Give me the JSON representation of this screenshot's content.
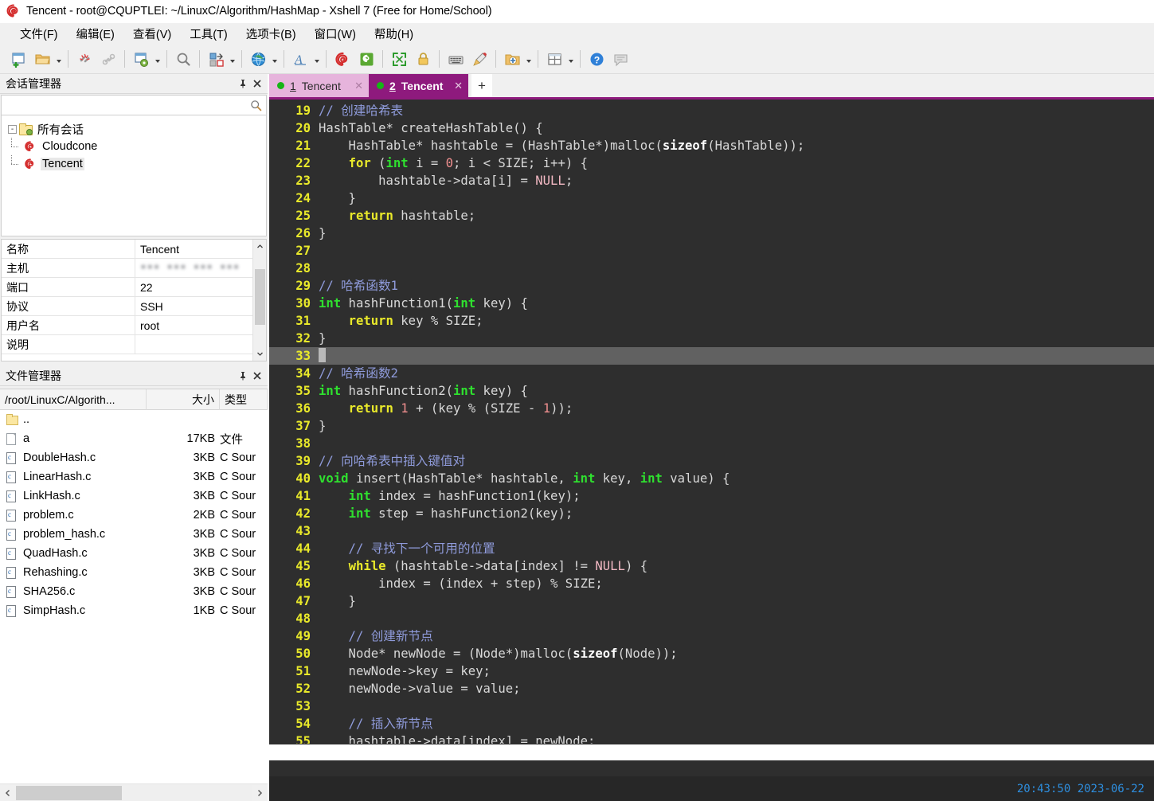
{
  "window": {
    "title": "Tencent - root@CQUPTLEI: ~/LinuxC/Algorithm/HashMap - Xshell 7 (Free for Home/School)",
    "logo_icon": "xshell-logo-icon"
  },
  "menubar": {
    "items": [
      {
        "label": "文件(F)",
        "name": "menu-file"
      },
      {
        "label": "编辑(E)",
        "name": "menu-edit"
      },
      {
        "label": "查看(V)",
        "name": "menu-view"
      },
      {
        "label": "工具(T)",
        "name": "menu-tools"
      },
      {
        "label": "选项卡(B)",
        "name": "menu-tabs"
      },
      {
        "label": "窗口(W)",
        "name": "menu-window"
      },
      {
        "label": "帮助(H)",
        "name": "menu-help"
      }
    ]
  },
  "toolbar": {
    "buttons": [
      "new-session-icon",
      "open-folder-icon",
      "disconnect-icon",
      "link-icon",
      "session-properties-icon",
      "find-icon",
      "transfer-files-icon",
      "globe-icon",
      "font-icon",
      "xshell-icon",
      "xftp-icon",
      "fullscreen-icon",
      "lock-icon",
      "keyboard-icon",
      "highlight-icon",
      "add-folder-icon",
      "layout-icon",
      "help-icon",
      "feedback-icon"
    ]
  },
  "session_manager": {
    "title": "会话管理器",
    "pin_icon": "pin-icon",
    "close_icon": "close-icon",
    "search_placeholder": "",
    "search_value": "",
    "search_icon": "search-icon",
    "tree": {
      "root_label": "所有会话",
      "root_expanded": "-",
      "children": [
        {
          "label": "Cloudcone",
          "selected": false
        },
        {
          "label": "Tencent",
          "selected": true
        }
      ]
    }
  },
  "properties": {
    "rows": [
      {
        "key": "名称",
        "value": "Tencent",
        "blurred": false
      },
      {
        "key": "主机",
        "value": "••• ••• ••• •••",
        "blurred": true
      },
      {
        "key": "端口",
        "value": "22",
        "blurred": false
      },
      {
        "key": "协议",
        "value": "SSH",
        "blurred": false
      },
      {
        "key": "用户名",
        "value": "root",
        "blurred": false
      },
      {
        "key": "说明",
        "value": "",
        "blurred": false
      }
    ]
  },
  "file_manager": {
    "title": "文件管理器",
    "pin_icon": "pin-icon",
    "close_icon": "close-icon",
    "columns": {
      "path": "/root/LinuxC/Algorith...",
      "size": "大小",
      "type": "类型"
    },
    "rows": [
      {
        "name": "..",
        "size": "",
        "type": "",
        "icon": "folder-up-icon"
      },
      {
        "name": "a",
        "size": "17KB",
        "type": "文件",
        "icon": "file-icon"
      },
      {
        "name": "DoubleHash.c",
        "size": "3KB",
        "type": "C Sour",
        "icon": "c-source-icon"
      },
      {
        "name": "LinearHash.c",
        "size": "3KB",
        "type": "C Sour",
        "icon": "c-source-icon"
      },
      {
        "name": "LinkHash.c",
        "size": "3KB",
        "type": "C Sour",
        "icon": "c-source-icon"
      },
      {
        "name": "problem.c",
        "size": "2KB",
        "type": "C Sour",
        "icon": "c-source-icon"
      },
      {
        "name": "problem_hash.c",
        "size": "3KB",
        "type": "C Sour",
        "icon": "c-source-icon"
      },
      {
        "name": "QuadHash.c",
        "size": "3KB",
        "type": "C Sour",
        "icon": "c-source-icon"
      },
      {
        "name": "Rehashing.c",
        "size": "3KB",
        "type": "C Sour",
        "icon": "c-source-icon"
      },
      {
        "name": "SHA256.c",
        "size": "3KB",
        "type": "C Sour",
        "icon": "c-source-icon"
      },
      {
        "name": "SimpHash.c",
        "size": "1KB",
        "type": "C Sour",
        "icon": "c-source-icon"
      }
    ],
    "scroll_left_icon": "chevron-left-icon",
    "scroll_right_icon": "chevron-right-icon"
  },
  "tabs": {
    "items": [
      {
        "num": "1",
        "label": "Tencent",
        "active": false
      },
      {
        "num": "2",
        "label": "Tencent",
        "active": true
      }
    ],
    "add_label": "+",
    "close_icon": "close-icon",
    "active_color": "#8e1a7d",
    "inactive_color": "#e6b4dc"
  },
  "terminal": {
    "cursor_line": 33,
    "lines": [
      {
        "n": "19",
        "tokens": [
          {
            "t": "// 创建哈希表",
            "c": "cmt"
          }
        ]
      },
      {
        "n": "20",
        "tokens": [
          {
            "t": "HashTable* createHashTable() {",
            "c": "txt"
          }
        ]
      },
      {
        "n": "21",
        "tokens": [
          {
            "t": "    HashTable* hashtable = (HashTable*)malloc(",
            "c": "txt"
          },
          {
            "t": "sizeof",
            "c": "szof"
          },
          {
            "t": "(HashTable));",
            "c": "txt"
          }
        ]
      },
      {
        "n": "22",
        "tokens": [
          {
            "t": "    ",
            "c": "txt"
          },
          {
            "t": "for",
            "c": "kw"
          },
          {
            "t": " (",
            "c": "txt"
          },
          {
            "t": "int",
            "c": "type"
          },
          {
            "t": " i = ",
            "c": "txt"
          },
          {
            "t": "0",
            "c": "num"
          },
          {
            "t": "; i < SIZE; i++) {",
            "c": "txt"
          }
        ]
      },
      {
        "n": "23",
        "tokens": [
          {
            "t": "        hashtable->data[i] = ",
            "c": "txt"
          },
          {
            "t": "NULL",
            "c": "null"
          },
          {
            "t": ";",
            "c": "txt"
          }
        ]
      },
      {
        "n": "24",
        "tokens": [
          {
            "t": "    }",
            "c": "txt"
          }
        ]
      },
      {
        "n": "25",
        "tokens": [
          {
            "t": "    ",
            "c": "txt"
          },
          {
            "t": "return",
            "c": "kw"
          },
          {
            "t": " hashtable;",
            "c": "txt"
          }
        ]
      },
      {
        "n": "26",
        "tokens": [
          {
            "t": "}",
            "c": "txt"
          }
        ]
      },
      {
        "n": "27",
        "tokens": []
      },
      {
        "n": "28",
        "tokens": []
      },
      {
        "n": "29",
        "tokens": [
          {
            "t": "// 哈希函数1",
            "c": "cmt"
          }
        ]
      },
      {
        "n": "30",
        "tokens": [
          {
            "t": "int",
            "c": "type"
          },
          {
            "t": " hashFunction1(",
            "c": "txt"
          },
          {
            "t": "int",
            "c": "type"
          },
          {
            "t": " key) {",
            "c": "txt"
          }
        ]
      },
      {
        "n": "31",
        "tokens": [
          {
            "t": "    ",
            "c": "txt"
          },
          {
            "t": "return",
            "c": "kw"
          },
          {
            "t": " key % SIZE;",
            "c": "txt"
          }
        ]
      },
      {
        "n": "32",
        "tokens": [
          {
            "t": "}",
            "c": "txt"
          }
        ]
      },
      {
        "n": "33",
        "tokens": [],
        "cursor": true
      },
      {
        "n": "34",
        "tokens": [
          {
            "t": "// 哈希函数2",
            "c": "cmt"
          }
        ]
      },
      {
        "n": "35",
        "tokens": [
          {
            "t": "int",
            "c": "type"
          },
          {
            "t": " hashFunction2(",
            "c": "txt"
          },
          {
            "t": "int",
            "c": "type"
          },
          {
            "t": " key) {",
            "c": "txt"
          }
        ]
      },
      {
        "n": "36",
        "tokens": [
          {
            "t": "    ",
            "c": "txt"
          },
          {
            "t": "return",
            "c": "kw"
          },
          {
            "t": " ",
            "c": "txt"
          },
          {
            "t": "1",
            "c": "num"
          },
          {
            "t": " + (key % (SIZE - ",
            "c": "txt"
          },
          {
            "t": "1",
            "c": "num"
          },
          {
            "t": "));",
            "c": "txt"
          }
        ]
      },
      {
        "n": "37",
        "tokens": [
          {
            "t": "}",
            "c": "txt"
          }
        ]
      },
      {
        "n": "38",
        "tokens": []
      },
      {
        "n": "39",
        "tokens": [
          {
            "t": "// 向哈希表中插入键值对",
            "c": "cmt"
          }
        ]
      },
      {
        "n": "40",
        "tokens": [
          {
            "t": "void",
            "c": "type"
          },
          {
            "t": " insert(HashTable* hashtable, ",
            "c": "txt"
          },
          {
            "t": "int",
            "c": "type"
          },
          {
            "t": " key, ",
            "c": "txt"
          },
          {
            "t": "int",
            "c": "type"
          },
          {
            "t": " value) {",
            "c": "txt"
          }
        ]
      },
      {
        "n": "41",
        "tokens": [
          {
            "t": "    ",
            "c": "txt"
          },
          {
            "t": "int",
            "c": "type"
          },
          {
            "t": " index = hashFunction1(key);",
            "c": "txt"
          }
        ]
      },
      {
        "n": "42",
        "tokens": [
          {
            "t": "    ",
            "c": "txt"
          },
          {
            "t": "int",
            "c": "type"
          },
          {
            "t": " step = hashFunction2(key);",
            "c": "txt"
          }
        ]
      },
      {
        "n": "43",
        "tokens": []
      },
      {
        "n": "44",
        "tokens": [
          {
            "t": "    // 寻找下一个可用的位置",
            "c": "cmt"
          }
        ]
      },
      {
        "n": "45",
        "tokens": [
          {
            "t": "    ",
            "c": "txt"
          },
          {
            "t": "while",
            "c": "kw"
          },
          {
            "t": " (hashtable->data[index] != ",
            "c": "txt"
          },
          {
            "t": "NULL",
            "c": "null"
          },
          {
            "t": ") {",
            "c": "txt"
          }
        ]
      },
      {
        "n": "46",
        "tokens": [
          {
            "t": "        index = (index + step) % SIZE;",
            "c": "txt"
          }
        ]
      },
      {
        "n": "47",
        "tokens": [
          {
            "t": "    }",
            "c": "txt"
          }
        ]
      },
      {
        "n": "48",
        "tokens": []
      },
      {
        "n": "49",
        "tokens": [
          {
            "t": "    // 创建新节点",
            "c": "cmt"
          }
        ]
      },
      {
        "n": "50",
        "tokens": [
          {
            "t": "    Node* newNode = (Node*)malloc(",
            "c": "txt"
          },
          {
            "t": "sizeof",
            "c": "szof"
          },
          {
            "t": "(Node));",
            "c": "txt"
          }
        ]
      },
      {
        "n": "51",
        "tokens": [
          {
            "t": "    newNode->key = key;",
            "c": "txt"
          }
        ]
      },
      {
        "n": "52",
        "tokens": [
          {
            "t": "    newNode->value = value;",
            "c": "txt"
          }
        ]
      },
      {
        "n": "53",
        "tokens": []
      },
      {
        "n": "54",
        "tokens": [
          {
            "t": "    // 插入新节点",
            "c": "cmt"
          }
        ]
      },
      {
        "n": "55",
        "tokens": [
          {
            "t": "    hashtable->data[index] = newNode;",
            "c": "txt"
          }
        ]
      }
    ]
  },
  "statusbar": {
    "time": "20:43:50 2023-06-22"
  }
}
